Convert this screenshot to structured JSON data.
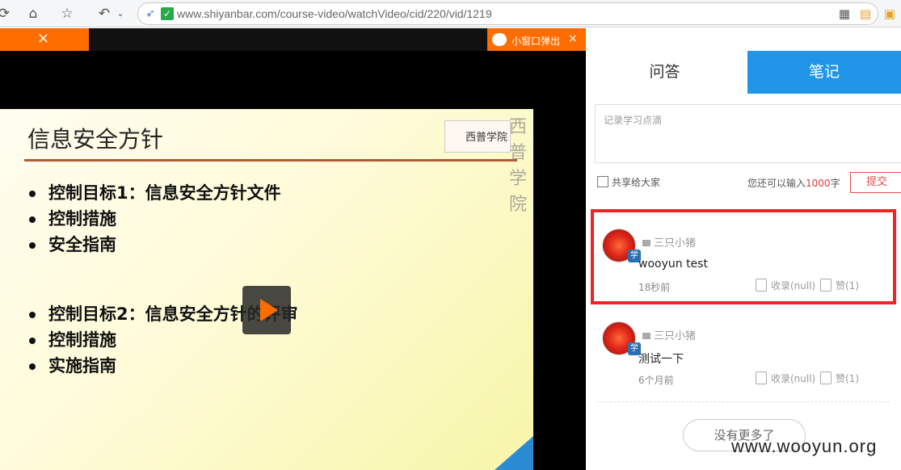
{
  "browser": {
    "url": "www.shiyanbar.com/course-video/watchVideo/cid/220/vid/1219"
  },
  "video": {
    "tab_close": "×",
    "popup_label": "小窗口弹出",
    "popup_close": "×",
    "slide": {
      "title": "信息安全方针",
      "logo_text": "西普学院",
      "brand": "西普学院",
      "bullets": [
        "控制目标1：信息安全方针文件",
        "控制措施",
        "安全指南",
        "控制目标2：信息安全方针的评审",
        "控制措施",
        "实施指南"
      ]
    }
  },
  "panel": {
    "tabs": [
      {
        "label": "问答",
        "active": false
      },
      {
        "label": "笔记",
        "active": true
      }
    ],
    "note_placeholder": "记录学习点滴",
    "share_label": "共享给大家",
    "count_prefix": "您还可以输入",
    "count_num": "1000",
    "count_suffix": "字",
    "submit_label": "提交",
    "notes": [
      {
        "user": "三只小猪",
        "badge": "学",
        "content": "wooyun test",
        "time": "18秒前",
        "fav": "收录(null)",
        "like": "赞(1)",
        "highlighted": true
      },
      {
        "user": "三只小猪",
        "badge": "学",
        "content": "测试一下",
        "time": "6个月前",
        "fav": "收录(null)",
        "like": "赞(1)",
        "highlighted": false
      }
    ],
    "more_label": "没有更多了"
  },
  "watermark": "www.wooyun.org",
  "colors": {
    "accent": "#2196e9",
    "orange": "#ff6d00",
    "highlight": "#f02424"
  }
}
